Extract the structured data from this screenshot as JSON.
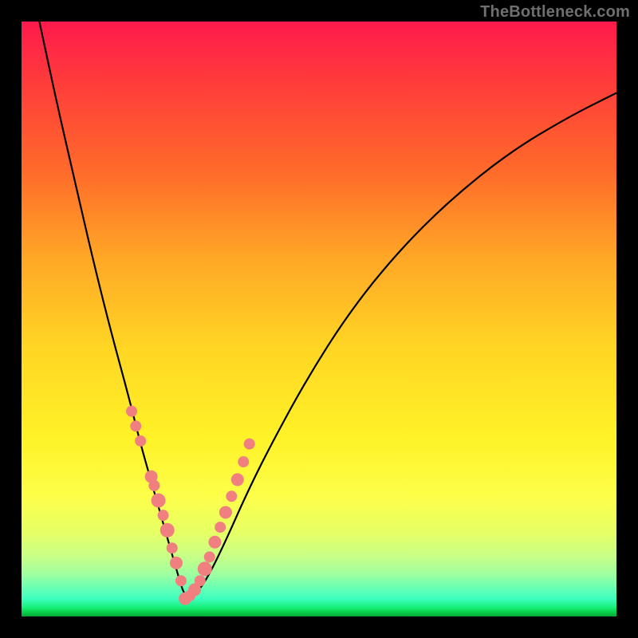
{
  "watermark": "TheBottleneck.com",
  "colors": {
    "frame": "#000000",
    "curve": "#000000",
    "dot_fill": "#f08080",
    "dot_stroke": "#d96b6b"
  },
  "chart_data": {
    "type": "line",
    "title": "",
    "xlabel": "",
    "ylabel": "",
    "xlim": [
      0,
      100
    ],
    "ylim": [
      0,
      100
    ],
    "grid": false,
    "legend": false,
    "note": "x and y are in percent of plot area; y=0 at bottom. Curve is a V-shaped bottleneck plot with minimum near x≈27.",
    "series": [
      {
        "name": "bottleneck-curve",
        "x": [
          0,
          3,
          6,
          9,
          12,
          15,
          18,
          20,
          22,
          24,
          26,
          27.5,
          29,
          31,
          34,
          38,
          42,
          48,
          55,
          63,
          72,
          82,
          92,
          100
        ],
        "y": [
          114,
          100,
          86,
          73,
          60,
          48,
          37,
          29,
          22,
          15,
          8,
          3,
          3.5,
          6,
          12,
          21,
          29,
          40,
          51,
          61,
          70,
          78,
          84,
          88
        ]
      }
    ],
    "dots": {
      "name": "highlighted-points",
      "x": [
        18.5,
        19.2,
        20.0,
        21.8,
        22.3,
        23.0,
        23.8,
        24.5,
        25.3,
        26.0,
        26.8,
        27.5,
        28.3,
        29.1,
        30.0,
        30.8,
        31.6,
        32.5,
        33.4,
        34.3,
        35.3,
        36.3,
        37.3,
        38.3
      ],
      "y": [
        34.5,
        32.0,
        29.5,
        23.5,
        22.0,
        19.5,
        17.0,
        14.5,
        11.5,
        9.0,
        6.0,
        3.0,
        3.5,
        4.5,
        6.0,
        8.0,
        10.0,
        12.5,
        15.0,
        17.5,
        20.2,
        23.0,
        26.0,
        29.0
      ],
      "r": [
        7,
        7,
        7,
        8,
        7,
        9,
        7,
        9,
        7,
        8,
        7,
        8,
        7,
        8,
        7,
        9,
        7,
        8,
        7,
        8,
        7,
        8,
        7,
        7
      ]
    }
  }
}
